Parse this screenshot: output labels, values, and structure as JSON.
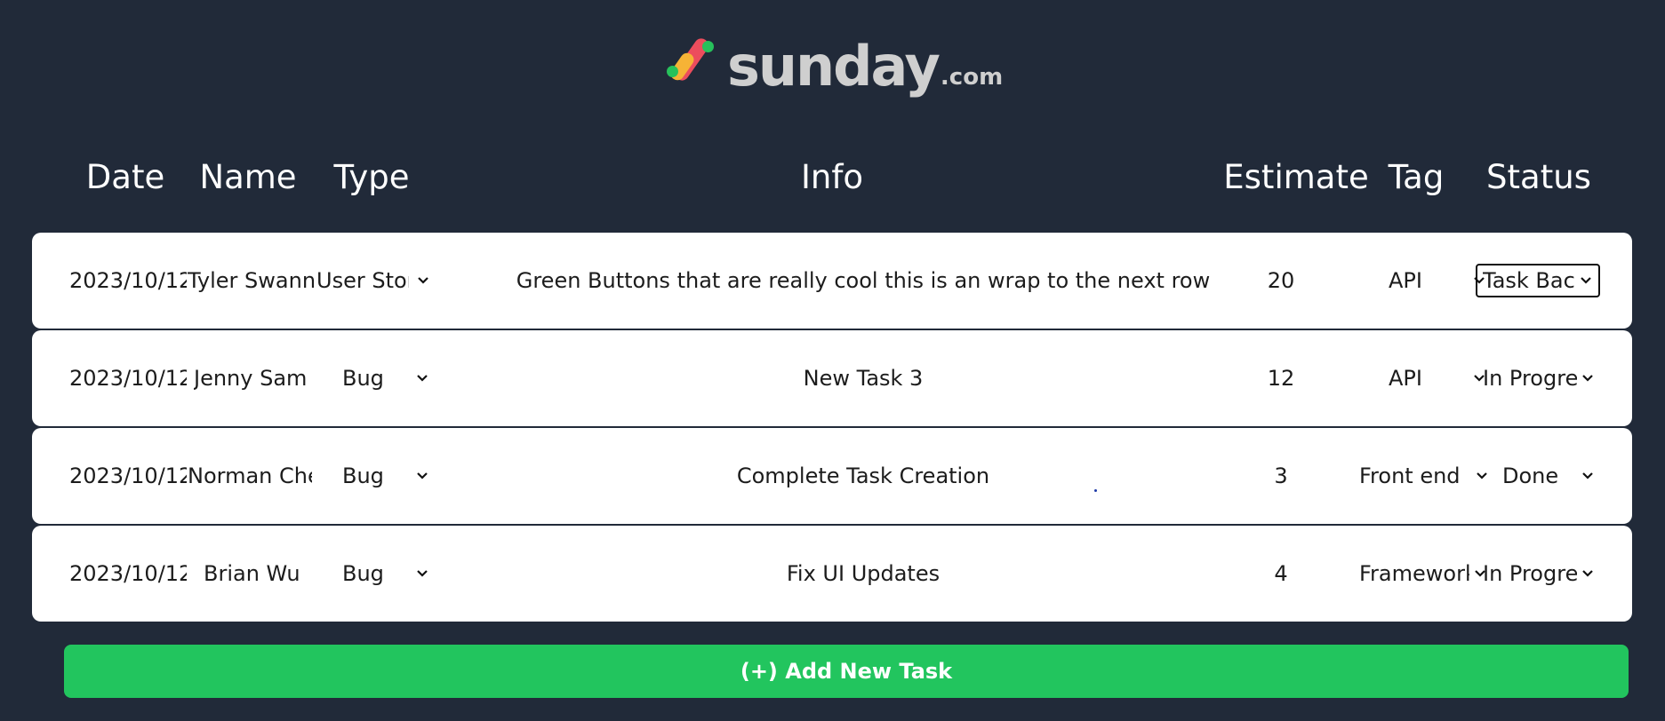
{
  "logo": {
    "word": "sunday",
    "suffix": ".com"
  },
  "columns": [
    "Date",
    "Name",
    "Type",
    "Info",
    "Estimate",
    "Tag",
    "Status"
  ],
  "tasks": [
    {
      "date": "2023/10/12",
      "name": "Tyler Swann",
      "type": "User Story",
      "info": "Green Buttons that are really cool this is an wrap to the next row",
      "estimate": "20",
      "tag": "API",
      "status": "Task Backlog"
    },
    {
      "date": "2023/10/12",
      "name": "Jenny Sam",
      "type": "Bug",
      "info": "New Task 3",
      "estimate": "12",
      "tag": "API",
      "status": "In Progress"
    },
    {
      "date": "2023/10/12",
      "name": "Norman Chen",
      "type": "Bug",
      "info": "Complete Task Creation",
      "estimate": "3",
      "tag": "Front end",
      "status": "Done"
    },
    {
      "date": "2023/10/12",
      "name": "Brian Wu",
      "type": "Bug",
      "info": "Fix UI Updates",
      "estimate": "4",
      "tag": "Framework",
      "status": "In Progress"
    }
  ],
  "add_button": {
    "label": "(+) Add New Task"
  },
  "colors": {
    "background": "#212a39",
    "row": "#ffffff",
    "accent": "#22c55e"
  },
  "icons": {
    "dropdown": "chevron-down-icon"
  }
}
